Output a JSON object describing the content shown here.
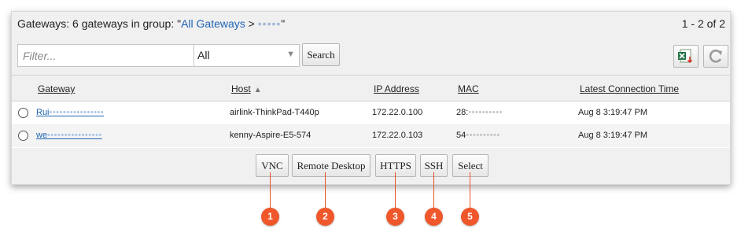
{
  "header": {
    "title_prefix": "Gateways: 6 gateways in group: \"",
    "group_link": "All Gateways",
    "separator": " > ",
    "subgroup": "•••••",
    "title_suffix": "\"",
    "pager": "1 - 2 of 2"
  },
  "filter": {
    "placeholder": "Filter...",
    "select_value": "All",
    "search_label": "Search"
  },
  "toolbar_icons": [
    "excel-export-icon",
    "refresh-icon"
  ],
  "table": {
    "columns": [
      "Gateway",
      "Host",
      "IP Address",
      "MAC",
      "Latest Connection Time"
    ],
    "sorted_column": "Host",
    "rows": [
      {
        "gateway_prefix": "Rui",
        "gateway_rest": "••••••••••••••••",
        "host": "airlink-ThinkPad-T440p",
        "ip": "172.22.0.100",
        "mac_prefix": "28:",
        "mac_rest": "••••••••••",
        "time": "Aug 8 3:19:47 PM"
      },
      {
        "gateway_prefix": "we",
        "gateway_rest": "••••••••••••••••",
        "host": "kenny-Aspire-E5-574",
        "ip": "172.22.0.103",
        "mac_prefix": "54",
        "mac_rest": "••••••••••",
        "time": "Aug 8 3:19:47 PM"
      }
    ]
  },
  "actions": [
    "VNC",
    "Remote Desktop",
    "HTTPS",
    "SSH",
    "Select"
  ],
  "callouts": [
    "1",
    "2",
    "3",
    "4",
    "5"
  ],
  "colors": {
    "link": "#1f64b4",
    "callout": "#f0572b",
    "panel_bg": "#f0f0f0"
  }
}
